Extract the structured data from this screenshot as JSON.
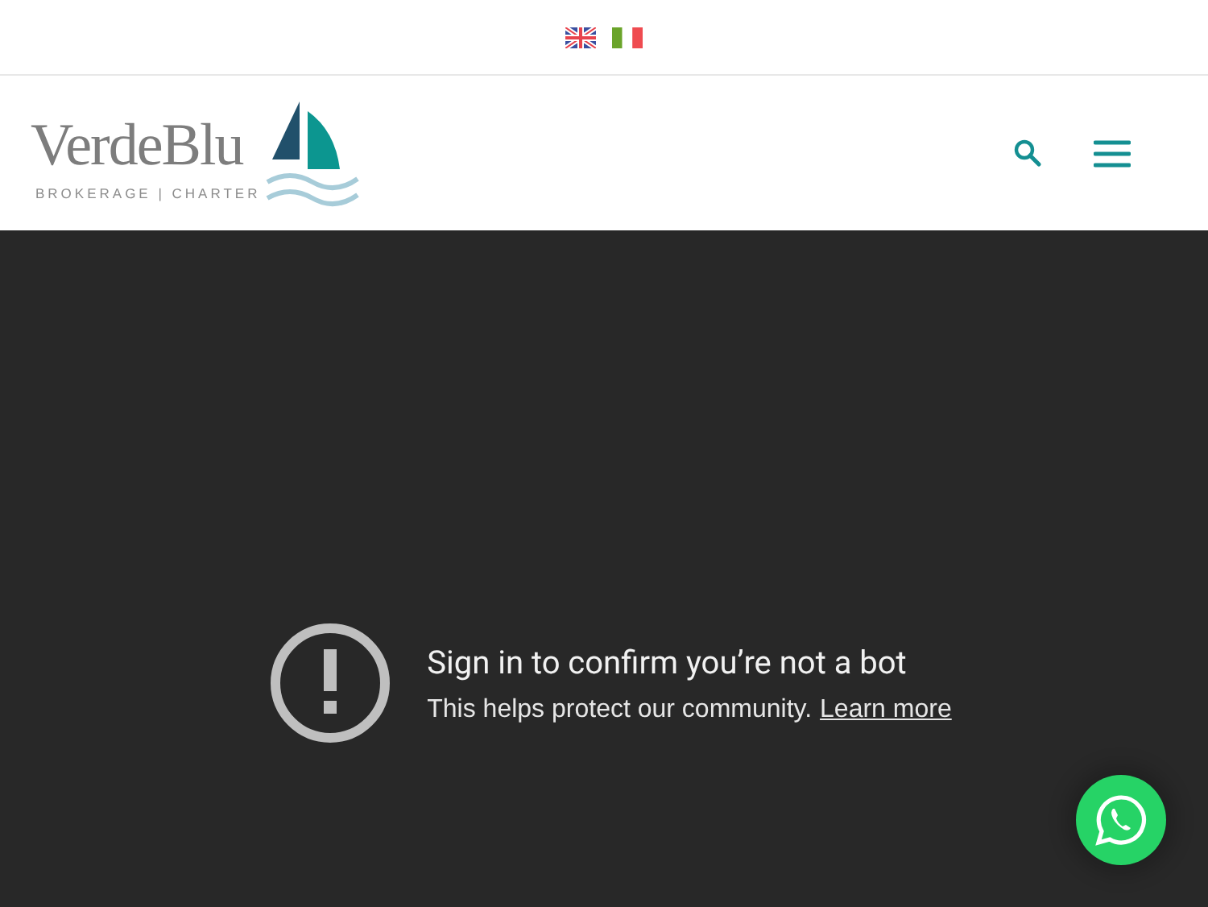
{
  "logo": {
    "name": "VerdeBlu",
    "tagline": "BROKERAGE | CHARTER"
  },
  "notice": {
    "title": "Sign in to confirm you’re not a bot",
    "message": "This helps protect our community.",
    "link": "Learn more"
  }
}
